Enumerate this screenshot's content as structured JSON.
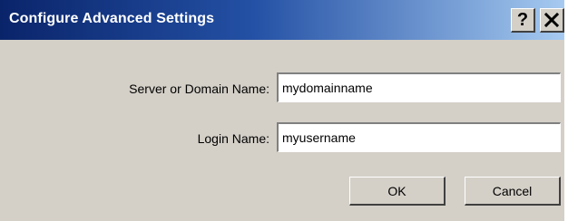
{
  "dialog": {
    "title": "Configure Advanced Settings",
    "help_glyph": "?",
    "close_icon": "close-icon"
  },
  "form": {
    "server_label": "Server or Domain Name:",
    "server_value": "mydomainname",
    "login_label": "Login Name:",
    "login_value": "myusername"
  },
  "buttons": {
    "ok_label": "OK",
    "cancel_label": "Cancel"
  },
  "colors": {
    "titlebar_start": "#0a246a",
    "titlebar_end": "#a6caf0",
    "dialog_face": "#d4d0c8"
  }
}
